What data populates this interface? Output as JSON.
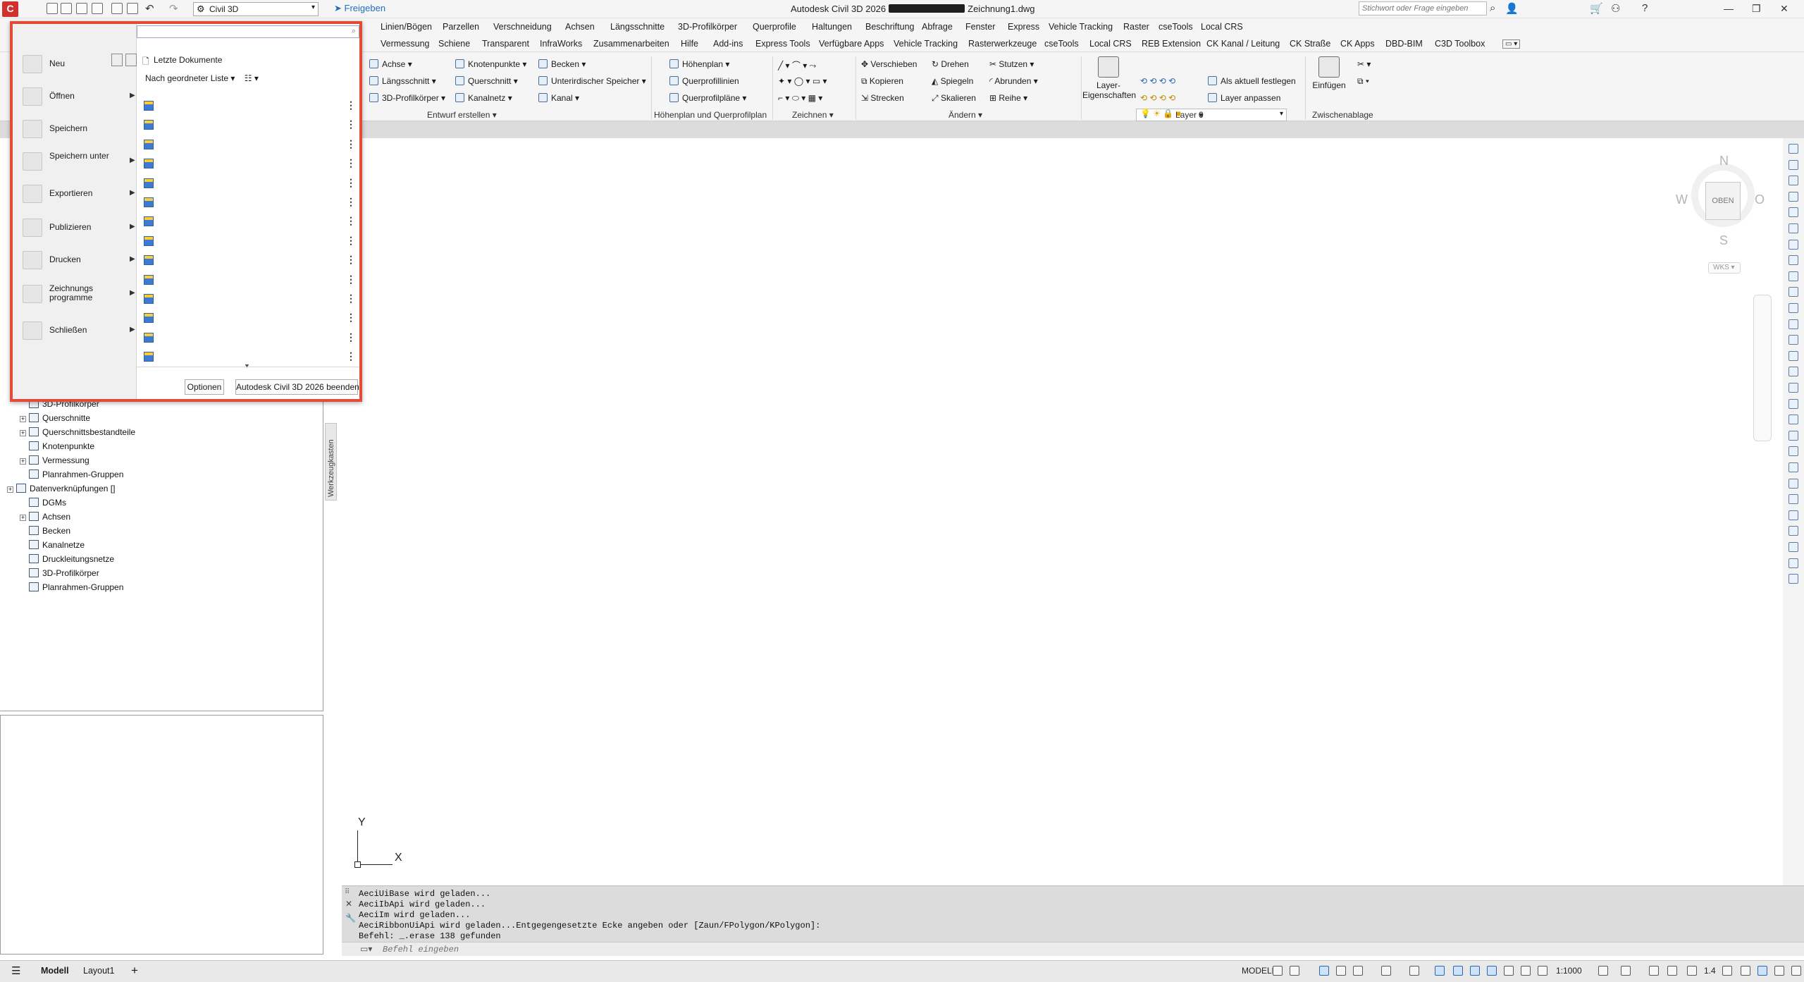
{
  "window": {
    "title_left": "Autodesk Civil 3D 2026",
    "title_right": "Zeichnung1.dwg",
    "app_button": "C",
    "workspace": "Civil 3D",
    "share": "Freigeben",
    "search_placeholder": "Stichwort oder Frage eingeben"
  },
  "tabs_row1": [
    "Linien/Bögen",
    "Parzellen",
    "Verschneidung",
    "Achsen",
    "Längsschnitte",
    "3D-Profilkörper",
    "Querprofile",
    "Haltungen",
    "Beschriftung",
    "Abfrage",
    "Fenster",
    "Express",
    "Vehicle Tracking",
    "Raster",
    "cseTools",
    "Local CRS"
  ],
  "tabs_row2": [
    "Vermessung",
    "Schiene",
    "Transparent",
    "InfraWorks",
    "Zusammenarbeiten",
    "Hilfe",
    "Add-ins",
    "Express Tools",
    "Verfügbare Apps",
    "Vehicle Tracking",
    "Rasterwerkzeuge",
    "cseTools",
    "Local CRS",
    "REB Extension",
    "CK Kanal / Leitung",
    "CK Straße",
    "CK Apps",
    "DBD-BIM",
    "C3D Toolbox"
  ],
  "ribbon": {
    "entwurf": {
      "items": [
        "Achse",
        "Längsschnitt",
        "3D-Profilkörper",
        "Knotenpunkte",
        "Querschnitt",
        "Kanalnetz",
        "Becken",
        "Unterirdischer Speicher",
        "Kanal"
      ],
      "label": "Entwurf erstellen"
    },
    "hoehenplan": {
      "items": [
        "Höhenplan",
        "Querprofillinien",
        "Querprofilpläne"
      ],
      "label": "Höhenplan und Querprofilplan"
    },
    "zeichnen": {
      "label": "Zeichnen"
    },
    "aendern": {
      "items": [
        "Verschieben",
        "Drehen",
        "Stutzen",
        "Kopieren",
        "Spiegeln",
        "Abrunden",
        "Strecken",
        "Skalieren",
        "Reihe"
      ],
      "label": "Ändern"
    },
    "layer": {
      "big": "Layer-Eigenschaften",
      "current": "0",
      "items": [
        "Als aktuell festlegen",
        "Layer anpassen"
      ],
      "label": "Layer"
    },
    "clipboard": {
      "big": "Einfügen",
      "label": "Zwischenablage"
    }
  },
  "app_menu": {
    "items": [
      {
        "label": "Neu",
        "arrow": true
      },
      {
        "label": "Öffnen",
        "arrow": true
      },
      {
        "label": "Speichern",
        "arrow": false
      },
      {
        "label": "Speichern unter",
        "arrow": true
      },
      {
        "label": "Exportieren",
        "arrow": true
      },
      {
        "label": "Publizieren",
        "arrow": true
      },
      {
        "label": "Drucken",
        "arrow": true
      },
      {
        "label": "Zeichnungs programme",
        "arrow": true
      },
      {
        "label": "Schließen",
        "arrow": true
      }
    ],
    "recent_title": "Letzte Dokumente",
    "sort_label": "Nach geordneter Liste",
    "recent_count": 14,
    "options_button": "Optionen",
    "exit_button": "Autodesk Civil 3D 2026 beenden"
  },
  "toolspace": {
    "tab_label": "Werkzeugkasten",
    "tree": [
      {
        "label": "3D-Profilkörper",
        "indent": 1,
        "expander": false
      },
      {
        "label": "Querschnitte",
        "indent": 1,
        "expander": true
      },
      {
        "label": "Querschnittsbestandteile",
        "indent": 1,
        "expander": true
      },
      {
        "label": "Knotenpunkte",
        "indent": 1,
        "expander": false
      },
      {
        "label": "Vermessung",
        "indent": 1,
        "expander": true
      },
      {
        "label": "Planrahmen-Gruppen",
        "indent": 1,
        "expander": false
      },
      {
        "label": "Datenverknüpfungen []",
        "indent": 0,
        "expander": true
      },
      {
        "label": "DGMs",
        "indent": 1,
        "expander": false
      },
      {
        "label": "Achsen",
        "indent": 1,
        "expander": true
      },
      {
        "label": "Becken",
        "indent": 1,
        "expander": false
      },
      {
        "label": "Kanalnetze",
        "indent": 1,
        "expander": false
      },
      {
        "label": "Druckleitungsnetze",
        "indent": 1,
        "expander": false
      },
      {
        "label": "3D-Profilkörper",
        "indent": 1,
        "expander": false
      },
      {
        "label": "Planrahmen-Gruppen",
        "indent": 1,
        "expander": false
      }
    ]
  },
  "viewcube": {
    "n": "N",
    "w": "W",
    "o": "O",
    "s": "S",
    "top": "OBEN",
    "wks": "WKS"
  },
  "ucs": {
    "x": "X",
    "y": "Y"
  },
  "command": {
    "history": [
      "AeciUiBase wird geladen...",
      "AeciIbApi wird geladen...",
      "AeciIm wird geladen...",
      "AeciRibbonUiApi wird geladen...Entgegengesetzte Ecke angeben oder [Zaun/FPolygon/KPolygon]:",
      "Befehl: _.erase 138 gefunden"
    ],
    "placeholder": "Befehl eingeben"
  },
  "status": {
    "tabs": [
      "Modell",
      "Layout1"
    ],
    "add": "+",
    "model": "MODELL",
    "scale": "1:1000",
    "zoom": "1.4"
  }
}
